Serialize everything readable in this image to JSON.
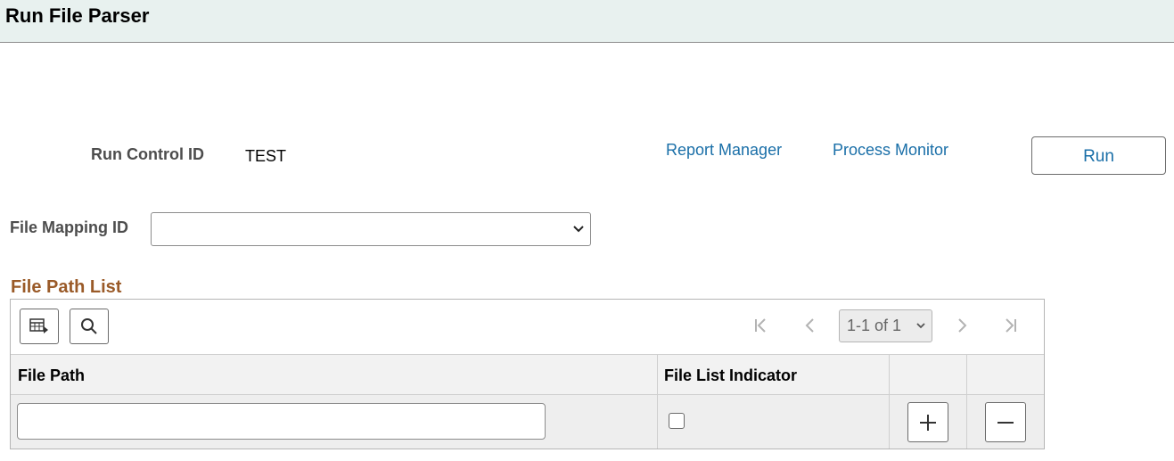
{
  "header": {
    "title": "Run File Parser"
  },
  "run_control": {
    "label": "Run Control ID",
    "value": "TEST",
    "report_manager_link": "Report Manager",
    "process_monitor_link": "Process Monitor",
    "run_button": "Run"
  },
  "file_mapping": {
    "label": "File Mapping ID",
    "value": ""
  },
  "grid": {
    "title": "File Path List",
    "pager_text": "1-1 of 1",
    "columns": [
      "File Path",
      "File List Indicator"
    ],
    "rows": [
      {
        "file_path": "",
        "file_list_indicator": false
      }
    ]
  },
  "icons": {
    "personalize": "grid-personalize-icon",
    "find": "search-icon",
    "first": "first-page-icon",
    "previous": "previous-page-icon",
    "next": "next-page-icon",
    "last": "last-page-icon",
    "add": "plus-icon",
    "delete": "minus-icon"
  }
}
